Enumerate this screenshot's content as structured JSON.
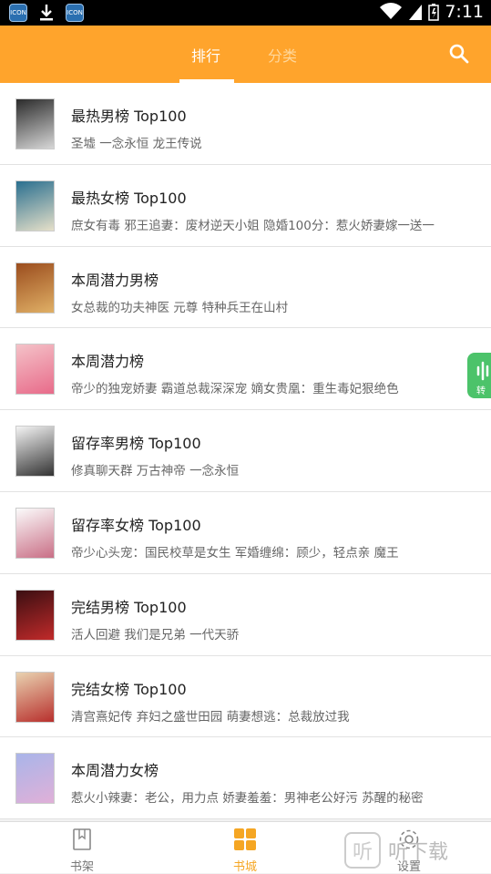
{
  "status_bar": {
    "time": "7:11",
    "app_icon_text": "ICON"
  },
  "tabs": [
    {
      "label": "排行",
      "active": true
    },
    {
      "label": "分类",
      "active": false
    }
  ],
  "list": [
    {
      "title": "最热男榜 Top100",
      "books": "圣墟 一念永恒 龙王传说",
      "cover_colors": [
        "#2b2b2b",
        "#d7d7d7"
      ]
    },
    {
      "title": "最热女榜 Top100",
      "books": "庶女有毒 邪王追妻：废材逆天小姐 隐婚100分：惹火娇妻嫁一送一",
      "cover_colors": [
        "#2a6f8f",
        "#e6e0c9"
      ]
    },
    {
      "title": "本周潜力男榜",
      "books": "女总裁的功夫神医 元尊 特种兵王在山村",
      "cover_colors": [
        "#9b4d1e",
        "#e0b066"
      ]
    },
    {
      "title": "本周潜力榜",
      "books": "帝少的独宠娇妻 霸道总裁深深宠 嫡女贵凰：重生毒妃狠绝色",
      "cover_colors": [
        "#f4c2c8",
        "#e86b8a"
      ]
    },
    {
      "title": "留存率男榜 Top100",
      "books": "修真聊天群 万古神帝 一念永恒",
      "cover_colors": [
        "#f4f4f4",
        "#333333"
      ]
    },
    {
      "title": "留存率女榜 Top100",
      "books": "帝少心头宠：国民校草是女生 军婚缠绵：顾少，轻点亲 魔王",
      "cover_colors": [
        "#fbfbfb",
        "#c96f86"
      ]
    },
    {
      "title": "完结男榜 Top100",
      "books": "活人回避 我们是兄弟 一代天骄",
      "cover_colors": [
        "#3b0f12",
        "#c12a2a"
      ]
    },
    {
      "title": "完结女榜 Top100",
      "books": "清宫熹妃传 弃妇之盛世田园 萌妻想逃：总裁放过我",
      "cover_colors": [
        "#e9d2b0",
        "#b8302d"
      ]
    },
    {
      "title": "本周潜力女榜",
      "books": "惹火小辣妻：老公，用力点 娇妻羞羞：男神老公好污 苏醒的秘密",
      "cover_colors": [
        "#a9b5e9",
        "#e0b0d8"
      ]
    }
  ],
  "float_button": {
    "label": "转"
  },
  "bottom_nav": [
    {
      "label": "书架",
      "active": false
    },
    {
      "label": "书城",
      "active": true
    },
    {
      "label": "设置",
      "active": false
    }
  ],
  "watermark": {
    "icon_char": "听",
    "text": "听下载"
  },
  "colors": {
    "accent": "#ffa42c",
    "active_nav": "#f5a623",
    "inactive_nav": "#777777"
  }
}
